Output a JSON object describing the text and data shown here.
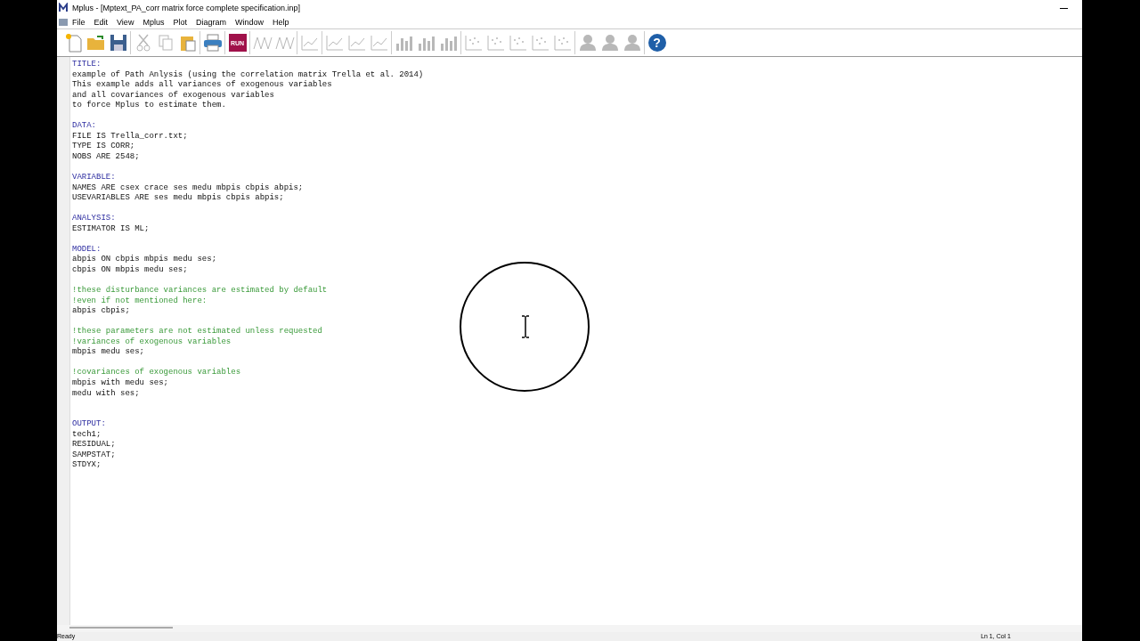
{
  "window": {
    "title": "Mplus - [Mptext_PA_corr matrix force complete specification.inp]"
  },
  "menu": [
    "File",
    "Edit",
    "View",
    "Mplus",
    "Plot",
    "Diagram",
    "Window",
    "Help"
  ],
  "toolbar": [
    {
      "kind": "new",
      "disabled": false
    },
    {
      "kind": "open",
      "disabled": false
    },
    {
      "kind": "save",
      "disabled": false
    },
    {
      "kind": "sep"
    },
    {
      "kind": "cut",
      "disabled": true
    },
    {
      "kind": "copy",
      "disabled": true
    },
    {
      "kind": "paste",
      "disabled": false
    },
    {
      "kind": "sep"
    },
    {
      "kind": "print",
      "disabled": false
    },
    {
      "kind": "sep"
    },
    {
      "kind": "run",
      "label": "RUN",
      "disabled": false
    },
    {
      "kind": "sep"
    },
    {
      "kind": "zigzag",
      "disabled": true
    },
    {
      "kind": "zigzag",
      "disabled": true
    },
    {
      "kind": "sep"
    },
    {
      "kind": "line",
      "disabled": true
    },
    {
      "kind": "sep"
    },
    {
      "kind": "line",
      "disabled": true
    },
    {
      "kind": "line",
      "disabled": true
    },
    {
      "kind": "line",
      "disabled": true
    },
    {
      "kind": "sep"
    },
    {
      "kind": "bars",
      "disabled": true
    },
    {
      "kind": "bars",
      "disabled": true
    },
    {
      "kind": "bars",
      "disabled": true
    },
    {
      "kind": "sep"
    },
    {
      "kind": "scatter",
      "disabled": true
    },
    {
      "kind": "scatter",
      "disabled": true
    },
    {
      "kind": "scatter",
      "disabled": true
    },
    {
      "kind": "scatter",
      "disabled": true
    },
    {
      "kind": "scatter",
      "disabled": true
    },
    {
      "kind": "sep"
    },
    {
      "kind": "person",
      "disabled": true
    },
    {
      "kind": "person",
      "disabled": true
    },
    {
      "kind": "person",
      "disabled": true
    },
    {
      "kind": "sep"
    },
    {
      "kind": "help",
      "label": "?",
      "disabled": false
    }
  ],
  "editor": {
    "lines": [
      {
        "kind": "keyword",
        "text": "TITLE:"
      },
      {
        "kind": "text",
        "text": "example of Path Anlysis (using the correlation matrix Trella et al. 2014)"
      },
      {
        "kind": "text",
        "text": "This example adds all variances of exogenous variables"
      },
      {
        "kind": "text",
        "text": "and all covariances of exogenous variables"
      },
      {
        "kind": "text",
        "text": "to force Mplus to estimate them."
      },
      {
        "kind": "blank"
      },
      {
        "kind": "keyword",
        "text": "DATA:"
      },
      {
        "kind": "text",
        "text": "FILE IS Trella_corr.txt;"
      },
      {
        "kind": "text",
        "text": "TYPE IS CORR;"
      },
      {
        "kind": "text",
        "text": "NOBS ARE 2548;"
      },
      {
        "kind": "blank"
      },
      {
        "kind": "keyword",
        "text": "VARIABLE:"
      },
      {
        "kind": "text",
        "text": "NAMES ARE csex crace ses medu mbpis cbpis abpis;"
      },
      {
        "kind": "text",
        "text": "USEVARIABLES ARE ses medu mbpis cbpis abpis;"
      },
      {
        "kind": "blank"
      },
      {
        "kind": "keyword",
        "text": "ANALYSIS:"
      },
      {
        "kind": "text",
        "text": "ESTIMATOR IS ML;"
      },
      {
        "kind": "blank"
      },
      {
        "kind": "keyword",
        "text": "MODEL:"
      },
      {
        "kind": "text",
        "text": "abpis ON cbpis mbpis medu ses;"
      },
      {
        "kind": "text",
        "text": "cbpis ON mbpis medu ses;"
      },
      {
        "kind": "blank"
      },
      {
        "kind": "comment",
        "text": "!these disturbance variances are estimated by default"
      },
      {
        "kind": "comment",
        "text": "!even if not mentioned here:"
      },
      {
        "kind": "text",
        "text": "abpis cbpis;"
      },
      {
        "kind": "blank"
      },
      {
        "kind": "comment",
        "text": "!these parameters are not estimated unless requested"
      },
      {
        "kind": "comment",
        "text": "!variances of exogenous variables"
      },
      {
        "kind": "text",
        "text": "mbpis medu ses;"
      },
      {
        "kind": "blank"
      },
      {
        "kind": "comment",
        "text": "!covariances of exogenous variables"
      },
      {
        "kind": "text",
        "text": "mbpis with medu ses;"
      },
      {
        "kind": "text",
        "text": "medu with ses;"
      },
      {
        "kind": "blank"
      },
      {
        "kind": "blank"
      },
      {
        "kind": "keyword",
        "text": "OUTPUT:"
      },
      {
        "kind": "text",
        "text": "tech1;"
      },
      {
        "kind": "text",
        "text": "RESIDUAL;"
      },
      {
        "kind": "text",
        "text": "SAMPSTAT;"
      },
      {
        "kind": "text",
        "text": "STDYX;"
      }
    ]
  },
  "status_bar": {
    "message": "Ready",
    "position": "Ln 1, Col 1"
  }
}
